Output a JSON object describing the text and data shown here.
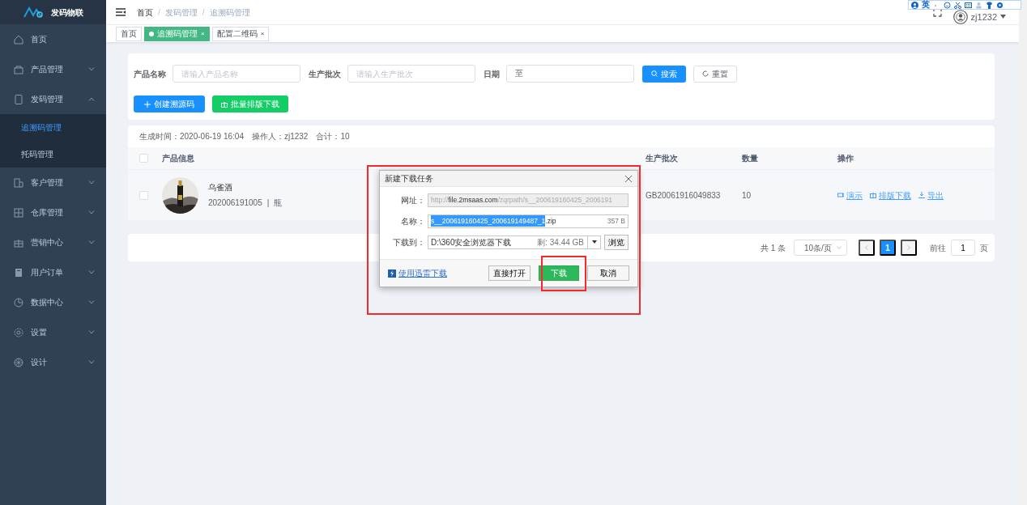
{
  "brand": {
    "name": "发码物联"
  },
  "sidebar": {
    "items": [
      {
        "label": "首页"
      },
      {
        "label": "产品管理",
        "expanded": false
      },
      {
        "label": "发码管理",
        "expanded": true,
        "children": [
          {
            "label": "追溯码管理",
            "selected": true
          },
          {
            "label": "托码管理",
            "selected": false
          }
        ]
      },
      {
        "label": "客户管理",
        "expanded": false
      },
      {
        "label": "仓库管理",
        "expanded": false
      },
      {
        "label": "营销中心",
        "expanded": false
      },
      {
        "label": "用户订单",
        "expanded": false
      },
      {
        "label": "数据中心",
        "expanded": false
      },
      {
        "label": "设置",
        "expanded": false
      },
      {
        "label": "设计",
        "expanded": false
      }
    ]
  },
  "breadcrumb": [
    "首页",
    "发码管理",
    "追溯码管理"
  ],
  "breadcrumb_separator": "/",
  "ime_toolbar": {
    "mode": "英"
  },
  "user": {
    "name": "zj1232"
  },
  "tags": [
    {
      "label": "首页",
      "selected": false
    },
    {
      "label": "追溯码管理",
      "selected": true,
      "close": "×"
    },
    {
      "label": "配置二维码",
      "selected": false,
      "close": "×"
    }
  ],
  "filters": [
    {
      "label": "产品名称",
      "placeholder": "请输入产品名称"
    },
    {
      "label": "生产批次",
      "placeholder": "请输入生产批次"
    },
    {
      "label": "日期",
      "value": "至"
    }
  ],
  "search_button": "搜索",
  "reset_button": "重置",
  "create_button": "创建溯源码",
  "batch_download_button": "批量排版下载",
  "summary": "生成时间：2020-06-19 16:04　操作人：zj1232　合计：10",
  "table": {
    "header_checked": false,
    "columns": [
      "产品信息",
      "生产批次",
      "数量",
      "操作"
    ],
    "rows": [
      {
        "checked": false,
        "name": "乌雀酒",
        "code": "202006191005",
        "separator": "|",
        "unit": "瓶",
        "batch": "GB20061916049833",
        "quantity": "10",
        "actions": [
          "演示",
          "排版下载",
          "导出"
        ]
      }
    ]
  },
  "pagination": {
    "total": "共 1 条",
    "page_size": "10条/页",
    "pages": [
      {
        "label": "1",
        "selected": true
      }
    ],
    "goto_label": "前往",
    "goto_value": "1",
    "goto_suffix": "页"
  },
  "dialog": {
    "title": "新建下载任务",
    "url_label": "网址：",
    "url": {
      "prefix": "http://",
      "host": "file.2msaas.com",
      "path": "/zqrpath/s__200619160425_2006191"
    },
    "name_label": "名称：",
    "name_selected": "s__200619160425_200619149487_1",
    "name_rest": ".zip",
    "size": "357 B",
    "dest_label": "下载到：",
    "dest": "D:\\360安全浏览器下载",
    "free": "剩: 34.44 GB",
    "browse_button": "浏览",
    "thunder_link": "使用迅雷下载",
    "open_button": "直接打开",
    "download_button": "下载",
    "cancel_button": "取消"
  }
}
